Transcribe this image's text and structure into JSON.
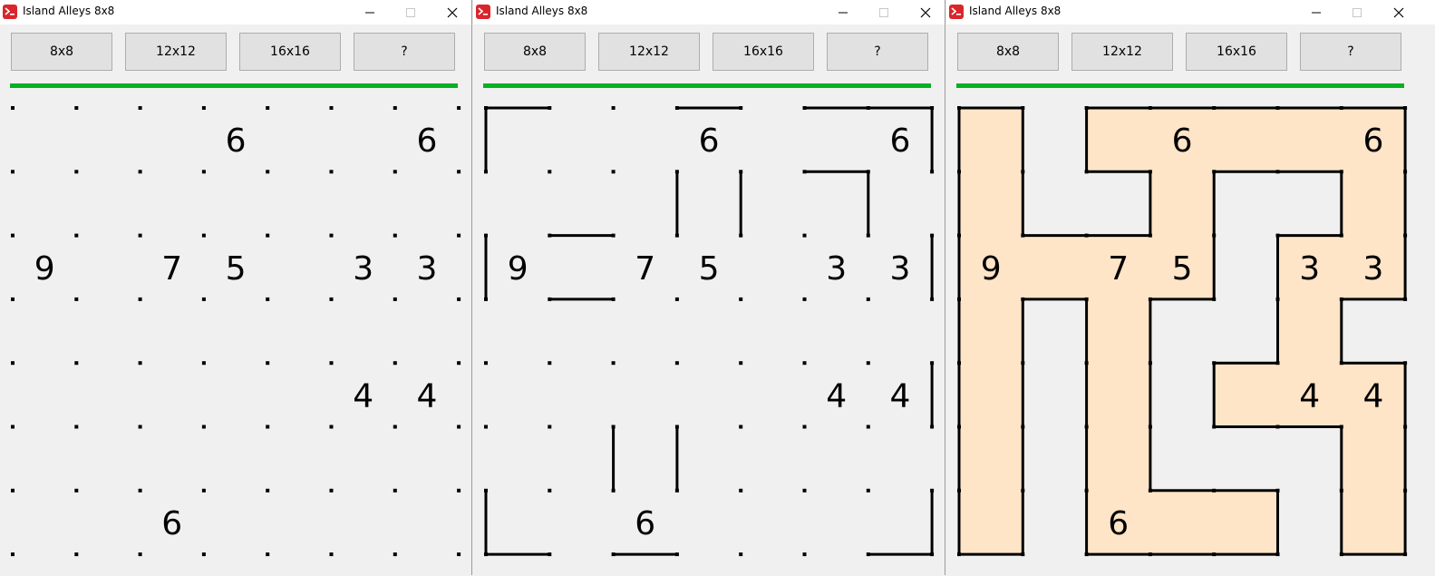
{
  "colors": {
    "accent_green": "#06b025",
    "island_fill": "#fee5c7",
    "wall": "#000000",
    "background": "#f0f0f0"
  },
  "grid_size": 7,
  "clues": [
    {
      "row": 0,
      "col": 3,
      "value": "6"
    },
    {
      "row": 0,
      "col": 6,
      "value": "6"
    },
    {
      "row": 2,
      "col": 0,
      "value": "9"
    },
    {
      "row": 2,
      "col": 2,
      "value": "7"
    },
    {
      "row": 2,
      "col": 3,
      "value": "5"
    },
    {
      "row": 2,
      "col": 5,
      "value": "3"
    },
    {
      "row": 2,
      "col": 6,
      "value": "3"
    },
    {
      "row": 4,
      "col": 5,
      "value": "4"
    },
    {
      "row": 4,
      "col": 6,
      "value": "4"
    },
    {
      "row": 6,
      "col": 2,
      "value": "6"
    }
  ],
  "windows": [
    {
      "title": "Island Alleys 8x8",
      "buttons": [
        "8x8",
        "12x12",
        "16x16",
        "?"
      ],
      "progress": 1.0,
      "icons": {
        "app": "app-icon",
        "minimize": "minimize-icon",
        "maximize": "maximize-icon",
        "close": "close-icon"
      },
      "walls": [],
      "filled_cells": []
    },
    {
      "title": "Island Alleys 8x8",
      "buttons": [
        "8x8",
        "12x12",
        "16x16",
        "?"
      ],
      "progress": 1.0,
      "icons": {
        "app": "app-icon",
        "minimize": "minimize-icon",
        "maximize": "maximize-icon",
        "close": "close-icon"
      },
      "walls": [
        [
          0,
          0,
          1,
          0
        ],
        [
          0,
          0,
          0,
          1
        ],
        [
          3,
          0,
          4,
          0
        ],
        [
          5,
          0,
          6,
          0
        ],
        [
          6,
          0,
          7,
          0
        ],
        [
          7,
          0,
          7,
          1
        ],
        [
          3,
          1,
          3,
          2
        ],
        [
          4,
          1,
          4,
          2
        ],
        [
          5,
          1,
          6,
          1
        ],
        [
          6,
          1,
          6,
          2
        ],
        [
          0,
          2,
          0,
          3
        ],
        [
          1,
          2,
          2,
          2
        ],
        [
          1,
          3,
          2,
          3
        ],
        [
          7,
          2,
          7,
          3
        ],
        [
          7,
          4,
          7,
          5
        ],
        [
          2,
          5,
          2,
          6
        ],
        [
          3,
          5,
          3,
          6
        ],
        [
          0,
          6,
          0,
          7
        ],
        [
          0,
          7,
          1,
          7
        ],
        [
          2,
          7,
          3,
          7
        ],
        [
          6,
          7,
          7,
          7
        ],
        [
          7,
          6,
          7,
          7
        ]
      ],
      "filled_cells": []
    },
    {
      "title": "Island Alleys 8x8",
      "buttons": [
        "8x8",
        "12x12",
        "16x16",
        "?"
      ],
      "progress": 1.0,
      "icons": {
        "app": "app-icon",
        "minimize": "minimize-icon",
        "maximize": "maximize-icon",
        "close": "close-icon"
      },
      "walls": [],
      "filled_cells": [
        [
          0,
          0
        ],
        [
          0,
          2
        ],
        [
          0,
          3
        ],
        [
          0,
          4
        ],
        [
          0,
          5
        ],
        [
          0,
          6
        ],
        [
          1,
          0
        ],
        [
          1,
          3
        ],
        [
          1,
          6
        ],
        [
          2,
          0
        ],
        [
          2,
          1
        ],
        [
          2,
          2
        ],
        [
          2,
          3
        ],
        [
          2,
          5
        ],
        [
          2,
          6
        ],
        [
          3,
          0
        ],
        [
          3,
          2
        ],
        [
          3,
          5
        ],
        [
          4,
          0
        ],
        [
          4,
          2
        ],
        [
          4,
          4
        ],
        [
          4,
          5
        ],
        [
          4,
          6
        ],
        [
          5,
          0
        ],
        [
          5,
          2
        ],
        [
          5,
          6
        ],
        [
          6,
          0
        ],
        [
          6,
          2
        ],
        [
          6,
          3
        ],
        [
          6,
          4
        ],
        [
          6,
          6
        ]
      ]
    }
  ]
}
